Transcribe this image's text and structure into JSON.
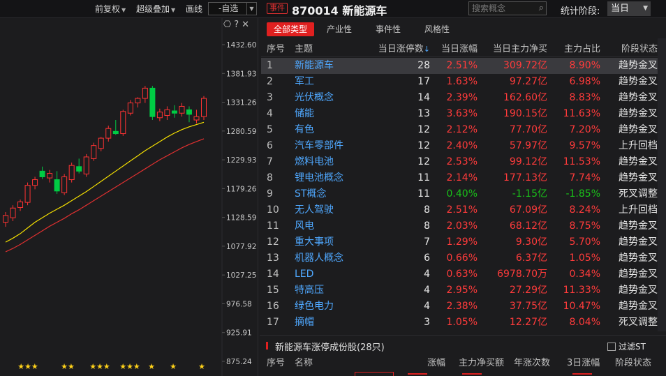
{
  "toolbar": {
    "adjust_label": "前复权",
    "overlay_label": "超级叠加",
    "draw_label": "画线",
    "custom_select": "-自选",
    "event_tag": "事件",
    "title": "870014 新能源车",
    "search_placeholder": "搜索概念",
    "stat_label": "统计阶段:",
    "stat_value": "当日"
  },
  "chart_data": {
    "type": "candlestick",
    "yticks": [
      "1432.60",
      "1381.93",
      "1331.26",
      "1280.59",
      "1229.93",
      "1179.26",
      "1128.59",
      "1077.92",
      "1027.25",
      "976.58",
      "925.91",
      "875.24"
    ],
    "ylim": [
      875.24,
      1432.6
    ],
    "colors": {
      "up": "#ff3333",
      "down": "#00cc44",
      "ma_short": "#f5e000",
      "ma_long": "#e03030"
    },
    "candles": [
      {
        "o": 1120,
        "h": 1138,
        "l": 1112,
        "c": 1132
      },
      {
        "o": 1128,
        "h": 1150,
        "l": 1122,
        "c": 1145
      },
      {
        "o": 1146,
        "h": 1160,
        "l": 1140,
        "c": 1156
      },
      {
        "o": 1155,
        "h": 1190,
        "l": 1150,
        "c": 1185
      },
      {
        "o": 1185,
        "h": 1200,
        "l": 1178,
        "c": 1195
      },
      {
        "o": 1210,
        "h": 1218,
        "l": 1196,
        "c": 1200
      },
      {
        "o": 1198,
        "h": 1212,
        "l": 1190,
        "c": 1206
      },
      {
        "o": 1195,
        "h": 1210,
        "l": 1170,
        "c": 1175
      },
      {
        "o": 1172,
        "h": 1205,
        "l": 1168,
        "c": 1200
      },
      {
        "o": 1195,
        "h": 1225,
        "l": 1190,
        "c": 1220
      },
      {
        "o": 1218,
        "h": 1232,
        "l": 1206,
        "c": 1210
      },
      {
        "o": 1205,
        "h": 1240,
        "l": 1200,
        "c": 1235
      },
      {
        "o": 1232,
        "h": 1260,
        "l": 1228,
        "c": 1255
      },
      {
        "o": 1250,
        "h": 1270,
        "l": 1245,
        "c": 1268
      },
      {
        "o": 1268,
        "h": 1290,
        "l": 1262,
        "c": 1285
      },
      {
        "o": 1280,
        "h": 1300,
        "l": 1274,
        "c": 1276
      },
      {
        "o": 1276,
        "h": 1318,
        "l": 1272,
        "c": 1315
      },
      {
        "o": 1312,
        "h": 1335,
        "l": 1308,
        "c": 1330
      },
      {
        "o": 1330,
        "h": 1340,
        "l": 1322,
        "c": 1338
      },
      {
        "o": 1338,
        "h": 1360,
        "l": 1330,
        "c": 1356
      },
      {
        "o": 1356,
        "h": 1360,
        "l": 1300,
        "c": 1306
      },
      {
        "o": 1304,
        "h": 1320,
        "l": 1298,
        "c": 1314
      },
      {
        "o": 1308,
        "h": 1324,
        "l": 1300,
        "c": 1318
      },
      {
        "o": 1316,
        "h": 1326,
        "l": 1304,
        "c": 1312
      },
      {
        "o": 1312,
        "h": 1330,
        "l": 1306,
        "c": 1324
      },
      {
        "o": 1318,
        "h": 1324,
        "l": 1296,
        "c": 1310
      },
      {
        "o": 1300,
        "h": 1318,
        "l": 1294,
        "c": 1306
      },
      {
        "o": 1306,
        "h": 1342,
        "l": 1300,
        "c": 1338
      }
    ],
    "ma_short": [
      1085,
      1092,
      1100,
      1110,
      1120,
      1128,
      1136,
      1143,
      1150,
      1158,
      1166,
      1174,
      1183,
      1192,
      1201,
      1210,
      1219,
      1228,
      1237,
      1246,
      1254,
      1262,
      1270,
      1277,
      1283,
      1288,
      1292,
      1296
    ],
    "ma_long": [
      1068,
      1074,
      1081,
      1089,
      1097,
      1105,
      1113,
      1120,
      1127,
      1135,
      1142,
      1150,
      1158,
      1166,
      1174,
      1182,
      1190,
      1198,
      1206,
      1214,
      1222,
      1230,
      1237,
      1244,
      1251,
      1257,
      1262,
      1267
    ],
    "stars": [
      "★★★",
      "★★",
      "★★★",
      "★★★",
      "★",
      "★",
      "★"
    ]
  },
  "tabs": [
    "全部类型",
    "产业性",
    "事件性",
    "风格性"
  ],
  "table": {
    "headers": {
      "idx": "序号",
      "name": "主题",
      "cnt": "当日涨停数",
      "pct": "当日涨幅",
      "net": "当日主力净买",
      "ratio": "主力占比",
      "stage": "阶段状态"
    },
    "sort_arrow": "↓",
    "rows": [
      {
        "idx": "1",
        "name": "新能源车",
        "cnt": "28",
        "pct": "2.51%",
        "net": "309.72亿",
        "ratio": "8.90%",
        "stage": "趋势金叉",
        "up": true
      },
      {
        "idx": "2",
        "name": "军工",
        "cnt": "17",
        "pct": "1.63%",
        "net": "97.27亿",
        "ratio": "6.98%",
        "stage": "趋势金叉",
        "up": true
      },
      {
        "idx": "3",
        "name": "光伏概念",
        "cnt": "14",
        "pct": "2.39%",
        "net": "162.60亿",
        "ratio": "8.83%",
        "stage": "趋势金叉",
        "up": true
      },
      {
        "idx": "4",
        "name": "储能",
        "cnt": "13",
        "pct": "3.63%",
        "net": "190.15亿",
        "ratio": "11.63%",
        "stage": "趋势金叉",
        "up": true
      },
      {
        "idx": "5",
        "name": "有色",
        "cnt": "12",
        "pct": "2.12%",
        "net": "77.70亿",
        "ratio": "7.20%",
        "stage": "趋势金叉",
        "up": true
      },
      {
        "idx": "6",
        "name": "汽车零部件",
        "cnt": "12",
        "pct": "2.40%",
        "net": "57.97亿",
        "ratio": "9.57%",
        "stage": "上升回档",
        "up": true
      },
      {
        "idx": "7",
        "name": "燃料电池",
        "cnt": "12",
        "pct": "2.53%",
        "net": "99.12亿",
        "ratio": "11.53%",
        "stage": "趋势金叉",
        "up": true
      },
      {
        "idx": "8",
        "name": "锂电池概念",
        "cnt": "11",
        "pct": "2.14%",
        "net": "177.13亿",
        "ratio": "7.74%",
        "stage": "趋势金叉",
        "up": true
      },
      {
        "idx": "9",
        "name": "ST概念",
        "cnt": "11",
        "pct": "0.40%",
        "net": "-1.15亿",
        "ratio": "-1.85%",
        "stage": "死叉调整",
        "up": false
      },
      {
        "idx": "10",
        "name": "无人驾驶",
        "cnt": "8",
        "pct": "2.51%",
        "net": "67.09亿",
        "ratio": "8.24%",
        "stage": "上升回档",
        "up": true
      },
      {
        "idx": "11",
        "name": "风电",
        "cnt": "8",
        "pct": "2.03%",
        "net": "68.12亿",
        "ratio": "8.75%",
        "stage": "趋势金叉",
        "up": true
      },
      {
        "idx": "12",
        "name": "重大事项",
        "cnt": "7",
        "pct": "1.29%",
        "net": "9.30亿",
        "ratio": "5.70%",
        "stage": "趋势金叉",
        "up": true
      },
      {
        "idx": "13",
        "name": "机器人概念",
        "cnt": "6",
        "pct": "0.66%",
        "net": "6.37亿",
        "ratio": "1.05%",
        "stage": "趋势金叉",
        "up": true
      },
      {
        "idx": "14",
        "name": "LED",
        "cnt": "4",
        "pct": "0.63%",
        "net": "6978.70万",
        "ratio": "0.34%",
        "stage": "趋势金叉",
        "up": true
      },
      {
        "idx": "15",
        "name": "特高压",
        "cnt": "4",
        "pct": "2.95%",
        "net": "27.29亿",
        "ratio": "11.33%",
        "stage": "趋势金叉",
        "up": true
      },
      {
        "idx": "16",
        "name": "绿色电力",
        "cnt": "4",
        "pct": "2.38%",
        "net": "37.75亿",
        "ratio": "10.47%",
        "stage": "趋势金叉",
        "up": true
      },
      {
        "idx": "17",
        "name": "摘帽",
        "cnt": "3",
        "pct": "1.05%",
        "net": "12.27亿",
        "ratio": "8.04%",
        "stage": "死叉调整",
        "up": true
      }
    ]
  },
  "bottom": {
    "title": "新能源车涨停成份股(28只)",
    "filter_st": "过滤ST",
    "headers": {
      "idx": "序号",
      "name": "名称",
      "chg": "涨幅",
      "net": "主力净买额",
      "years": "年涨次数",
      "chg3": "3日涨幅",
      "stage": "阶段状态"
    }
  }
}
